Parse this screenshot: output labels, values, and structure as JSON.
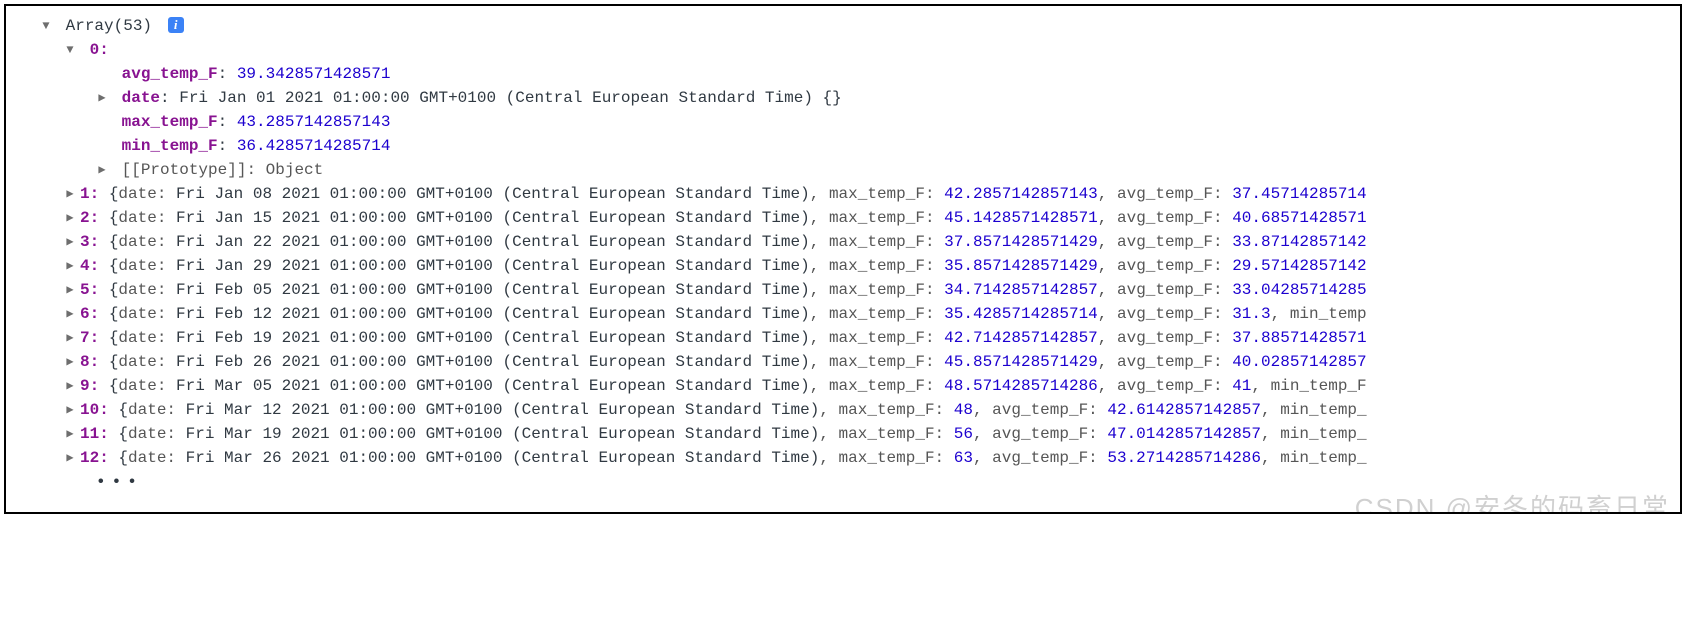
{
  "header": {
    "array_label": "Array",
    "array_count": "(53)",
    "info_badge": "i"
  },
  "expanded": {
    "index": "0",
    "avg_temp_F_key": "avg_temp_F",
    "avg_temp_F_val": "39.3428571428571",
    "date_key": "date",
    "date_val": "Fri Jan 01 2021 01:00:00 GMT+0100 (Central European Standard Time)",
    "date_obj": "{}",
    "max_temp_F_key": "max_temp_F",
    "max_temp_F_val": "43.2857142857143",
    "min_temp_F_key": "min_temp_F",
    "min_temp_F_val": "36.4285714285714",
    "proto_key": "[[Prototype]]",
    "proto_val": "Object"
  },
  "rows": [
    {
      "idx": "1",
      "date": "Fri Jan 08 2021 01:00:00 GMT+0100 (Central European Standard Time)",
      "k2": "max_temp_F",
      "v2": "42.2857142857143",
      "k3": "avg_temp_F",
      "v3": "37.45714285714"
    },
    {
      "idx": "2",
      "date": "Fri Jan 15 2021 01:00:00 GMT+0100 (Central European Standard Time)",
      "k2": "max_temp_F",
      "v2": "45.1428571428571",
      "k3": "avg_temp_F",
      "v3": "40.68571428571"
    },
    {
      "idx": "3",
      "date": "Fri Jan 22 2021 01:00:00 GMT+0100 (Central European Standard Time)",
      "k2": "max_temp_F",
      "v2": "37.8571428571429",
      "k3": "avg_temp_F",
      "v3": "33.87142857142"
    },
    {
      "idx": "4",
      "date": "Fri Jan 29 2021 01:00:00 GMT+0100 (Central European Standard Time)",
      "k2": "max_temp_F",
      "v2": "35.8571428571429",
      "k3": "avg_temp_F",
      "v3": "29.57142857142"
    },
    {
      "idx": "5",
      "date": "Fri Feb 05 2021 01:00:00 GMT+0100 (Central European Standard Time)",
      "k2": "max_temp_F",
      "v2": "34.7142857142857",
      "k3": "avg_temp_F",
      "v3": "33.04285714285"
    },
    {
      "idx": "6",
      "date": "Fri Feb 12 2021 01:00:00 GMT+0100 (Central European Standard Time)",
      "k2": "max_temp_F",
      "v2": "35.4285714285714",
      "k3": "avg_temp_F",
      "v3": "31.3",
      "trail": ", min_temp"
    },
    {
      "idx": "7",
      "date": "Fri Feb 19 2021 01:00:00 GMT+0100 (Central European Standard Time)",
      "k2": "max_temp_F",
      "v2": "42.7142857142857",
      "k3": "avg_temp_F",
      "v3": "37.88571428571"
    },
    {
      "idx": "8",
      "date": "Fri Feb 26 2021 01:00:00 GMT+0100 (Central European Standard Time)",
      "k2": "max_temp_F",
      "v2": "45.8571428571429",
      "k3": "avg_temp_F",
      "v3": "40.02857142857"
    },
    {
      "idx": "9",
      "date": "Fri Mar 05 2021 01:00:00 GMT+0100 (Central European Standard Time)",
      "k2": "max_temp_F",
      "v2": "48.5714285714286",
      "k3": "avg_temp_F",
      "v3": "41",
      "trail": ", min_temp_F"
    },
    {
      "idx": "10",
      "date": "Fri Mar 12 2021 01:00:00 GMT+0100 (Central European Standard Time)",
      "k2": "max_temp_F",
      "v2": "48",
      "k3": "avg_temp_F",
      "v3": "42.6142857142857",
      "trail": ", min_temp_"
    },
    {
      "idx": "11",
      "date": "Fri Mar 19 2021 01:00:00 GMT+0100 (Central European Standard Time)",
      "k2": "max_temp_F",
      "v2": "56",
      "k3": "avg_temp_F",
      "v3": "47.0142857142857",
      "trail": ", min_temp_"
    },
    {
      "idx": "12",
      "date": "Fri Mar 26 2021 01:00:00 GMT+0100 (Central European Standard Time)",
      "k2": "max_temp_F",
      "v2": "63",
      "k3": "avg_temp_F",
      "v3": "53.2714285714286",
      "trail": ", min_temp_"
    }
  ],
  "labels": {
    "date_key": "date",
    "colon": ": ",
    "comma": ", ",
    "lbrace": "{",
    "rbrace": "}",
    "ellipsis": "…"
  },
  "watermark": "CSDN @安冬的码畜日常"
}
